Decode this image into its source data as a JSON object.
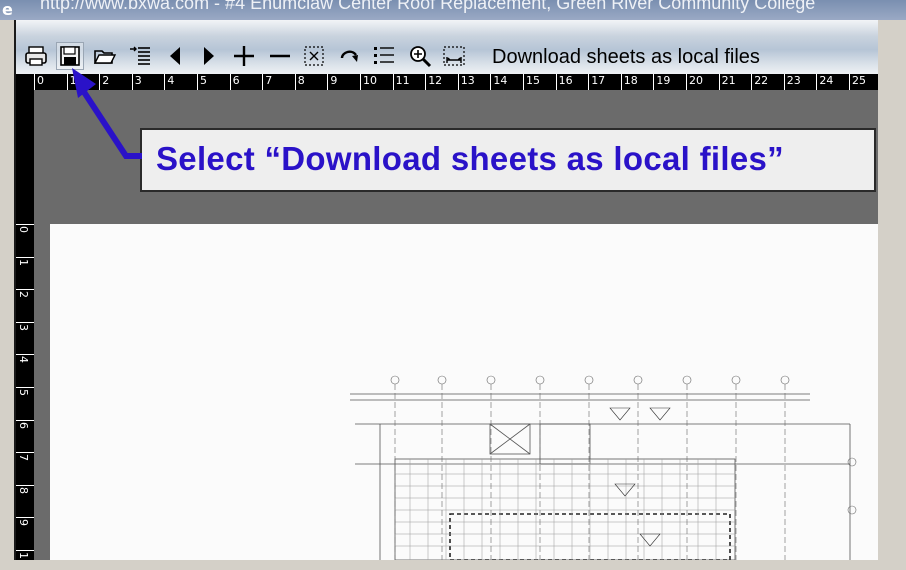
{
  "window": {
    "title": "http://www.bxwa.com - #4 Enumclaw Center Roof Replacement, Green River Community College"
  },
  "toolbar": {
    "caption": "Download sheets as local files",
    "buttons": [
      {
        "name": "print-icon"
      },
      {
        "name": "save-icon"
      },
      {
        "name": "open-folder-icon"
      },
      {
        "name": "sheet-list-icon"
      },
      {
        "name": "previous-page-icon"
      },
      {
        "name": "next-page-icon"
      },
      {
        "name": "zoom-in-plus-icon"
      },
      {
        "name": "zoom-out-minus-icon"
      },
      {
        "name": "fit-to-window-icon"
      },
      {
        "name": "rotate-icon"
      },
      {
        "name": "list-options-icon"
      },
      {
        "name": "magnify-icon"
      },
      {
        "name": "measure-icon"
      }
    ]
  },
  "ruler": {
    "horizontal_labels": [
      "0",
      "1",
      "2",
      "3",
      "4",
      "5",
      "6",
      "7",
      "8",
      "9",
      "10",
      "11",
      "12",
      "13",
      "14",
      "15",
      "16",
      "17",
      "18",
      "19",
      "20",
      "21",
      "22",
      "23",
      "24",
      "25"
    ],
    "vertical_labels": [
      "0",
      "1",
      "2",
      "3",
      "4",
      "5",
      "6",
      "7",
      "8",
      "9",
      "1"
    ]
  },
  "callout": {
    "text": "Select “Download sheets as local files”"
  },
  "colors": {
    "callout_text": "#2a12c8",
    "arrow": "#2a12c8",
    "viewer_background": "#6b6b6b",
    "ruler": "#000000"
  }
}
